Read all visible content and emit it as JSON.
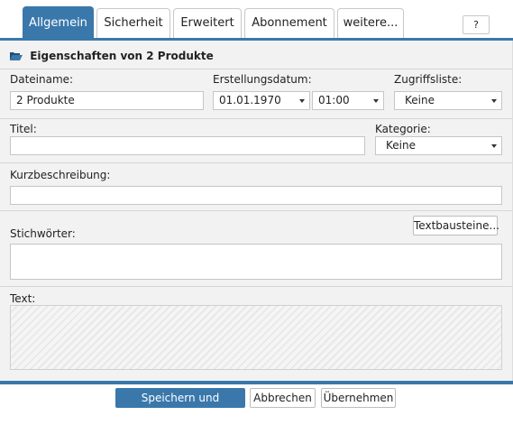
{
  "tabs": [
    {
      "label": "Allgemein",
      "active": true
    },
    {
      "label": "Sicherheit",
      "active": false
    },
    {
      "label": "Erweitert",
      "active": false
    },
    {
      "label": "Abonnement",
      "active": false
    },
    {
      "label": "weitere...",
      "active": false
    }
  ],
  "help_label": "?",
  "panel": {
    "title": "Eigenschaften von 2 Produkte",
    "icon": "folder-open-icon"
  },
  "fields": {
    "filename": {
      "label": "Dateiname:",
      "value": "2 Produkte"
    },
    "created": {
      "label": "Erstellungsdatum:",
      "date": "01.01.1970",
      "time": "01:00"
    },
    "acl": {
      "label": "Zugriffsliste:",
      "value": "Keine"
    },
    "title": {
      "label": "Titel:",
      "value": ""
    },
    "category": {
      "label": "Kategorie:",
      "value": "Keine"
    },
    "summary": {
      "label": "Kurzbeschreibung:",
      "value": ""
    },
    "keywords": {
      "label": "Stichwörter:",
      "value": "",
      "textblocks_button": "Textbausteine..."
    },
    "text": {
      "label": "Text:",
      "value": ""
    }
  },
  "footer": {
    "save_close": "Speichern und Schließen",
    "cancel": "Abbrechen",
    "apply": "Übernehmen"
  },
  "colors": {
    "accent": "#3a78ab",
    "panel_bg": "#f2f2f2"
  }
}
